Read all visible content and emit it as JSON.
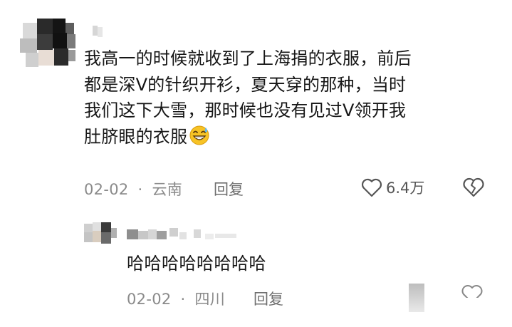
{
  "comment": {
    "text_lines": [
      "我高一的时候就收到了上海捐的衣服，前后",
      "都是深V的针织开衫，夏天穿的那种，当时",
      "我们这下大雪，那时候也没有见过V领开我",
      "肚脐眼的衣服"
    ],
    "emoji": "laughing-sweat-emoji",
    "date": "02-02",
    "separator": "·",
    "location": "云南",
    "reply_label": "回复",
    "like_count": "6.4万"
  },
  "reply": {
    "text": "哈哈哈哈哈哈哈哈",
    "date": "02-02",
    "separator": "·",
    "location": "四川",
    "reply_label": "回复"
  },
  "icons": {
    "like": "heart-outline-icon",
    "dislike": "broken-heart-icon",
    "reply_like": "heart-outline-icon"
  },
  "colors": {
    "text": "#161616",
    "meta": "#8a8a8a",
    "icon": "#555555"
  }
}
